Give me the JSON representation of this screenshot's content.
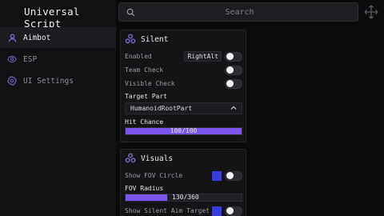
{
  "app": {
    "title": "Universal Script"
  },
  "search": {
    "placeholder": "Search"
  },
  "sidebar": {
    "items": [
      {
        "label": "Aimbot",
        "icon": "user-icon",
        "active": true
      },
      {
        "label": "ESP",
        "icon": "eye-icon",
        "active": false
      },
      {
        "label": "UI Settings",
        "icon": "gear-icon",
        "active": false
      }
    ]
  },
  "colors": {
    "accent": "#7a55ee",
    "swatch": "#3a3adf",
    "background": "#0b0b0c"
  },
  "silent": {
    "title": "Silent",
    "enabled_label": "Enabled",
    "enabled_key": "RightAlt",
    "team_check_label": "Team Check",
    "visible_check_label": "Visible Check",
    "target_part_label": "Target Part",
    "target_part_value": "HumanoidRootPart",
    "hit_chance_label": "Hit Chance",
    "hit_chance_value": "100/100",
    "hit_chance_fraction": 1.0
  },
  "visuals": {
    "title": "Visuals",
    "show_fov_label": "Show FOV Circle",
    "fov_radius_label": "FOV Radius",
    "fov_radius_value": "130/360",
    "fov_radius_fraction": 0.361,
    "show_target_label": "Show Silent Aim Target"
  }
}
